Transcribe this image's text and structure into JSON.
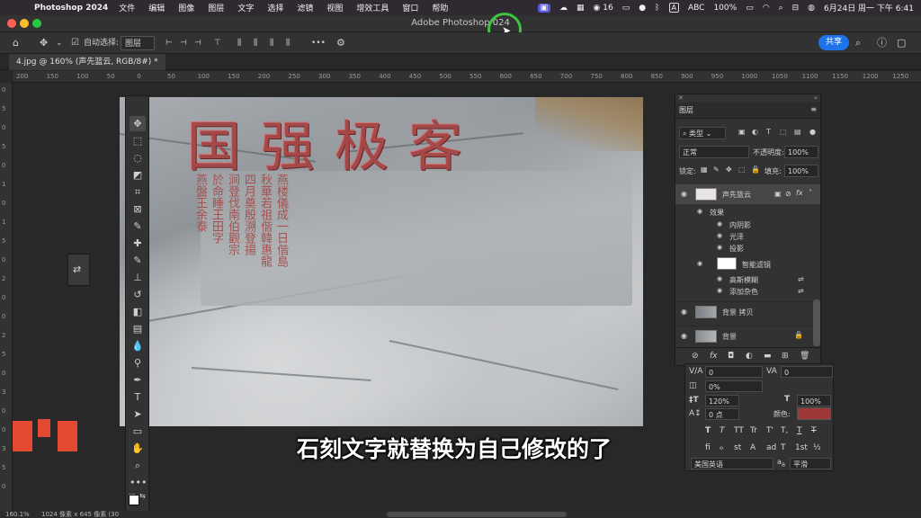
{
  "menubar": {
    "app_name": "Photoshop 2024",
    "items": [
      "文件",
      "编辑",
      "图像",
      "图层",
      "文字",
      "选择",
      "滤镜",
      "视图",
      "增效工具",
      "窗口",
      "帮助"
    ],
    "wechat_count": "16",
    "input_method": "ABC",
    "battery": "100%",
    "datetime": "6月24日 周一 下午 6:41"
  },
  "window": {
    "title": "Adobe Photoshop 2024",
    "title_visible": "Adobe Photoshop 024"
  },
  "options_bar": {
    "auto_select_label": "自动选择:",
    "auto_select_target": "图层",
    "share_label": "共享"
  },
  "document_tab": {
    "label": "4.jpg @ 160% (声先篮云, RGB/8#) *"
  },
  "ruler": {
    "top_ticks": [
      "200",
      "150",
      "100",
      "50",
      "0",
      "50",
      "100",
      "150",
      "200",
      "250",
      "300",
      "350",
      "400",
      "450",
      "500",
      "550",
      "600",
      "650",
      "700",
      "750",
      "800",
      "850",
      "900",
      "950",
      "1000",
      "1050",
      "1100",
      "1150",
      "1200",
      "1250"
    ],
    "left_ticks": [
      "0",
      "5",
      "0",
      "5",
      "0",
      "1",
      "0",
      "1",
      "5",
      "0",
      "2",
      "0",
      "0",
      "2",
      "5",
      "0",
      "3",
      "0",
      "0",
      "3",
      "5",
      "0"
    ]
  },
  "photo": {
    "main_inscription": "国强极客",
    "side_columns": [
      "燕楼儀成一日偕島",
      "秋華若祖偕韓惠龍",
      "四月奠殷溯登揚",
      "涧登伐南伯觀宗",
      "於命睡王田字",
      "燕盤王余泰"
    ]
  },
  "subtitle": "石刻文字就替换为自己修改的了",
  "layers_panel": {
    "tab_label": "图层",
    "filter_label": "类型",
    "blend_mode": "正常",
    "opacity_label": "不透明度:",
    "opacity_value": "100%",
    "lock_label": "锁定:",
    "fill_label": "填充:",
    "fill_value": "100%",
    "layers": [
      {
        "name": "声先篮云",
        "type": "text-smart",
        "selected": true
      },
      {
        "name": "背景 拷贝",
        "type": "image",
        "selected": false
      },
      {
        "name": "背景",
        "type": "image",
        "selected": false,
        "locked": true
      }
    ],
    "effects_label": "效果",
    "effects": [
      "内阴影",
      "光泽",
      "投影"
    ],
    "smart_filters_label": "智能滤镜",
    "smart_filters": [
      "高斯模糊",
      "添加杂色"
    ]
  },
  "character_panel": {
    "kerning_value": "0",
    "tracking_value": "0",
    "scale_percent": "0%",
    "vertical_scale": "120%",
    "horizontal_scale": "100%",
    "baseline_shift": "0 点",
    "color_label": "颜色:",
    "text_color": "#9c3838",
    "language": "美国英语",
    "antialias": "平滑",
    "style_buttons": [
      "T",
      "T",
      "TT",
      "Tr",
      "T'",
      "T,",
      "T",
      "T"
    ],
    "opentype_buttons": [
      "fi",
      "ℴ",
      "st",
      "A",
      "ad",
      "T",
      "1st",
      "½"
    ]
  },
  "status_bar": {
    "zoom": "160.1%",
    "doc_info": "1024 像素 x 645 像素 (30"
  }
}
